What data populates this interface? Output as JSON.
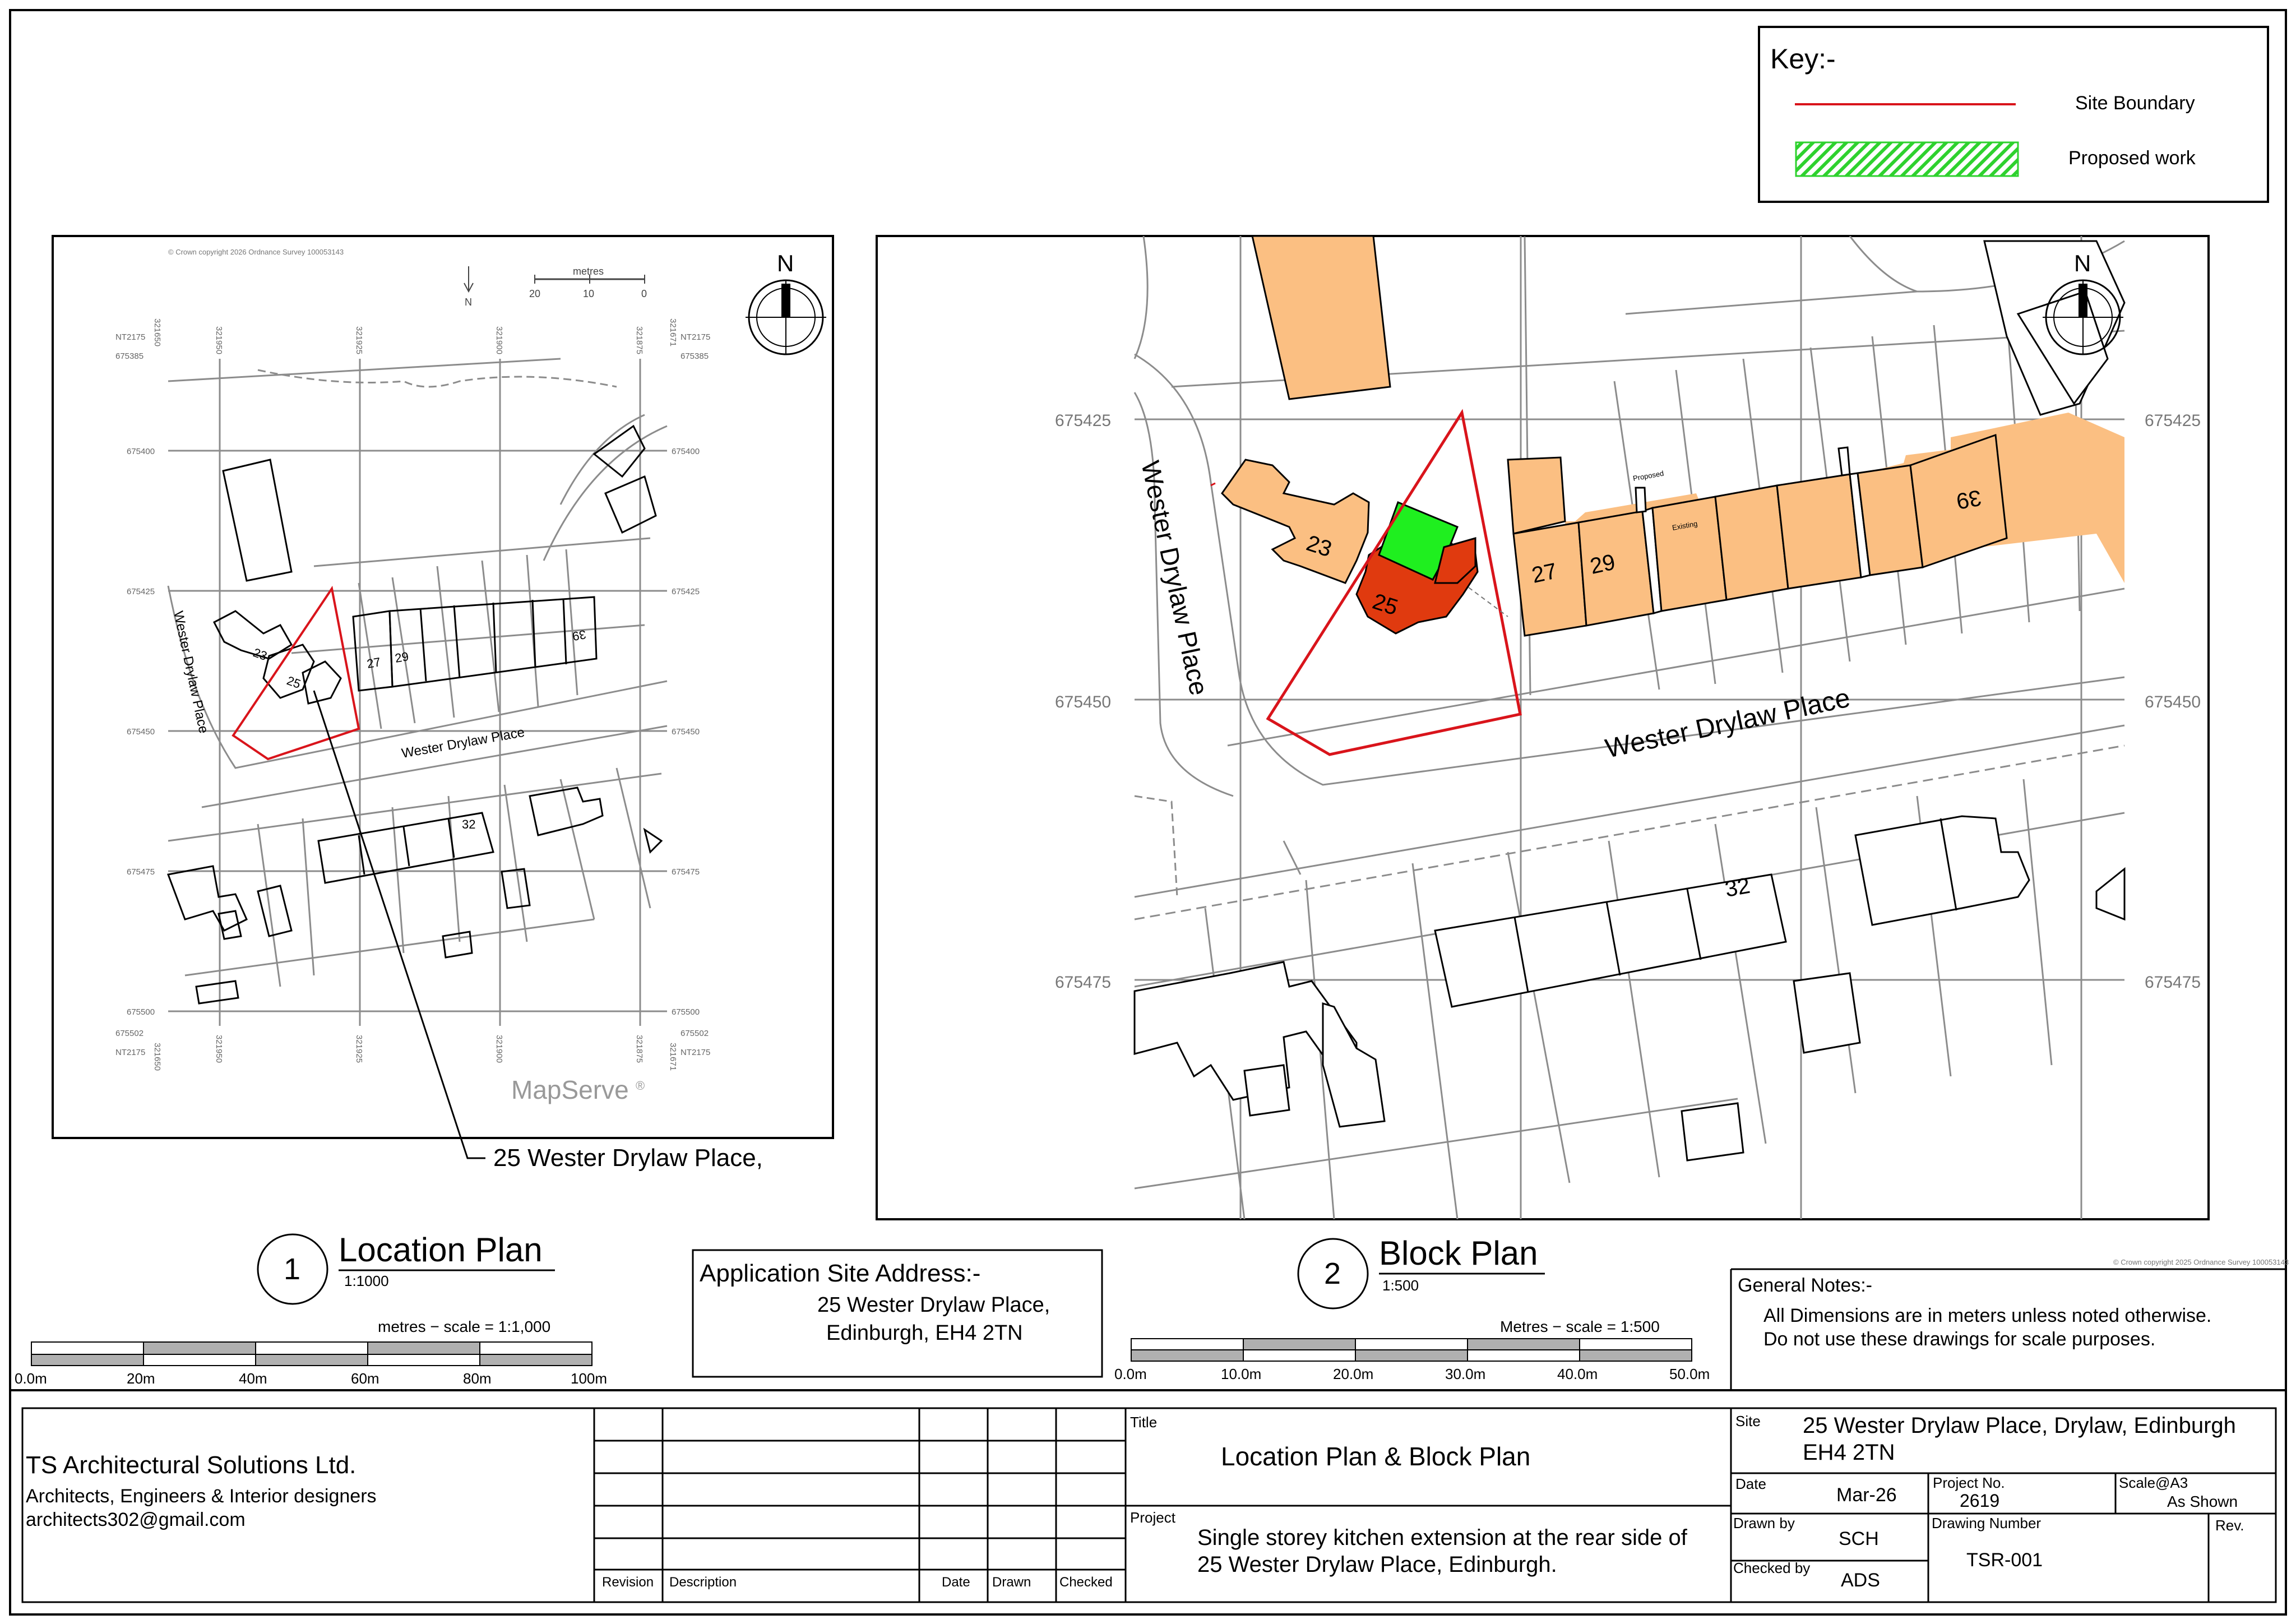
{
  "key": {
    "title": "Key:-",
    "items": [
      {
        "label": "Site Boundary",
        "color": "#d9141b"
      },
      {
        "label": "Proposed work",
        "color": "#2ed12e"
      }
    ]
  },
  "location_plan": {
    "copyright": "© Crown copyright 2026 Ordnance Survey 100053143",
    "north": "N",
    "scale_unit": "metres",
    "scale_ticks": [
      "20",
      "10",
      "0"
    ],
    "grid_refs": [
      "NT2175",
      "NT2175",
      "675385",
      "675385",
      "675502",
      "675502"
    ],
    "eastings": [
      "321650",
      "321950",
      "321925",
      "321900",
      "321875",
      "321671"
    ],
    "northings": [
      "675400",
      "675425",
      "675450",
      "675475",
      "675500"
    ],
    "street": "Wester Drylaw Place",
    "house_numbers": [
      "23",
      "25",
      "27",
      "29",
      "39",
      "32"
    ],
    "brand": "MapServe",
    "callout": "25 Wester Drylaw Place,",
    "number": "1",
    "title": "Location Plan",
    "scale": "1:1000",
    "scalebar_caption": "metres  −  scale  =  1:1,000",
    "scalebar_labels": [
      "0.0m",
      "20m",
      "40m",
      "60m",
      "80m",
      "100m"
    ]
  },
  "block_plan": {
    "copyright": "© Crown copyright 2025 Ordnance Survey 100053143",
    "north": "N",
    "northings": [
      "675425",
      "675450",
      "675475"
    ],
    "street": "Wester Drylaw Place",
    "house_numbers": [
      "23",
      "25",
      "27",
      "29",
      "39",
      "32"
    ],
    "proposed_label": "Proposed",
    "existing_label": "Existing",
    "number": "2",
    "title": "Block Plan",
    "scale": "1:500",
    "scalebar_caption": "Metres  −  scale  =  1:500",
    "scalebar_labels": [
      "0.0m",
      "10.0m",
      "20.0m",
      "30.0m",
      "40.0m",
      "50.0m"
    ]
  },
  "application_site": {
    "heading": "Application Site Address:-",
    "line1": "25 Wester Drylaw Place,",
    "line2": "Edinburgh, EH4 2TN"
  },
  "general_notes": {
    "heading": "General Notes:-",
    "line1": "All Dimensions are in meters unless noted otherwise.",
    "line2": "Do not use these drawings for scale purposes."
  },
  "title_block": {
    "company": "TS Architectural Solutions Ltd.",
    "tagline": "Architects, Engineers & Interior designers",
    "email": "architects302@gmail.com",
    "revision_headers": [
      "Revision",
      "Description",
      "Date",
      "Drawn",
      "Checked"
    ],
    "title_label": "Title",
    "title_value": "Location Plan & Block Plan",
    "project_label": "Project",
    "project_line1": "Single storey kitchen extension at the rear side of",
    "project_line2": "25 Wester Drylaw Place, Edinburgh.",
    "site_label": "Site",
    "site_line1": "25 Wester Drylaw Place, Drylaw, Edinburgh",
    "site_line2": "EH4 2TN",
    "date_label": "Date",
    "date_value": "Mar-26",
    "project_no_label": "Project No.",
    "project_no_value": "2619",
    "scale_label": "Scale@A3",
    "scale_value": "As Shown",
    "drawn_by_label": "Drawn by",
    "drawn_by_value": "SCH",
    "drawing_number_label": "Drawing Number",
    "drawing_number_value": "TSR-001",
    "rev_label": "Rev.",
    "checked_by_label": "Checked by",
    "checked_by_value": "ADS"
  }
}
